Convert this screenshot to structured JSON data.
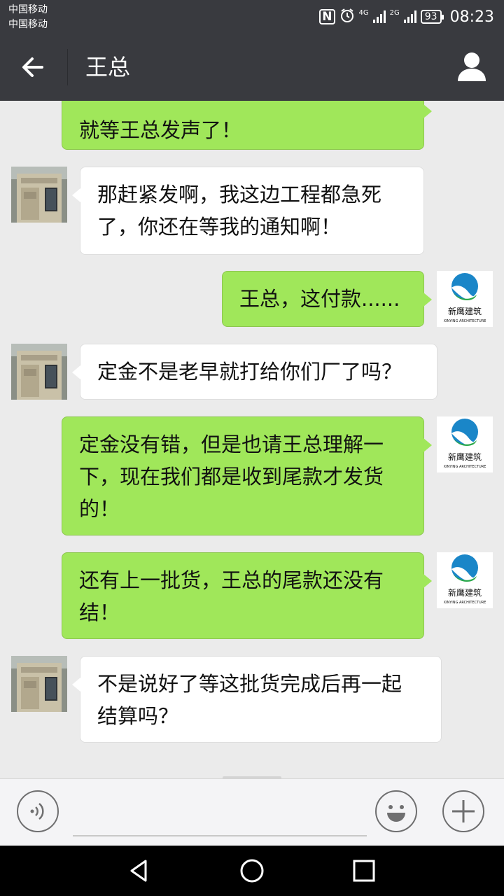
{
  "status_bar": {
    "carrier_1": "中国移动",
    "carrier_2": "中国移动",
    "nfc_icon": "nfc-icon",
    "alarm_icon": "alarm-icon",
    "network_1": "4G",
    "network_2": "2G",
    "battery": "93",
    "time": "08:23"
  },
  "header": {
    "back_icon": "arrow-left-icon",
    "title": "王总",
    "profile_icon": "person-icon",
    "background": "#393a3f"
  },
  "messages": [
    {
      "side": "me",
      "text_lines": [
        "就等王总发声了！"
      ],
      "partial": true
    },
    {
      "side": "them",
      "text_lines": [
        "那赶紧发啊，我这边工程都急死",
        "了，你还在等我的通知啊！"
      ]
    },
    {
      "side": "me",
      "text_lines": [
        "王总，这付款......"
      ]
    },
    {
      "side": "them",
      "text_lines": [
        "定金不是老早就打给你们厂了吗？"
      ]
    },
    {
      "side": "me",
      "text_lines": [
        "定金没有错，但是也请王总理解一",
        "下，现在我们都是收到尾款才发货",
        "的！"
      ]
    },
    {
      "side": "me",
      "text_lines": [
        "还有上一批货，王总的尾款还没有",
        "结！"
      ]
    },
    {
      "side": "them",
      "text_lines": [
        "不是说好了等这批货完成后再一起",
        "结算吗？"
      ]
    }
  ],
  "my_avatar": {
    "line_1": "新鹰建筑",
    "line_2": "XINYING ARCHITECTURE"
  },
  "input_bar": {
    "voice_icon": "voice-icon",
    "input_value": "",
    "emoji_icon": "smiley-icon",
    "plus_icon": "plus-icon"
  },
  "nav_bar": {
    "back_icon": "triangle-back-icon",
    "home_icon": "circle-home-icon",
    "recents_icon": "square-recents-icon"
  },
  "colors": {
    "my_bubble": "#a0e75a",
    "their_bubble": "#ffffff",
    "chat_background": "#ebebeb"
  }
}
